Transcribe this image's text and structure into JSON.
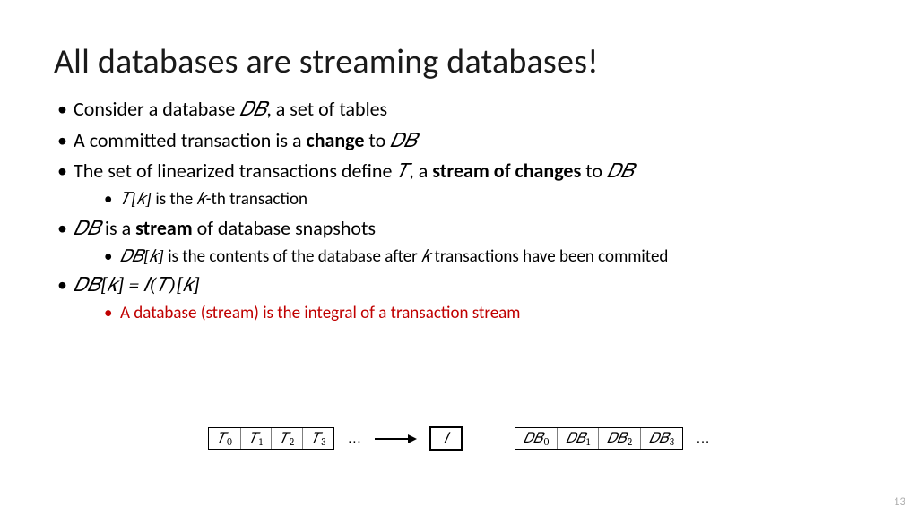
{
  "title": "All databases are streaming databases!",
  "bullets": {
    "b1_pre": "Consider a database ",
    "b1_mid": "𝐷𝐵",
    "b1_post": ", a set of tables",
    "b2_pre": "A committed transaction is a ",
    "b2_bold": "change",
    "b2_post": " to ",
    "b2_math": "𝐷𝐵",
    "b3_pre": "The set of linearized transactions define ",
    "b3_math1": "𝑇",
    "b3_mid": ", a ",
    "b3_bold": "stream of changes",
    "b3_post": " to ",
    "b3_math2": "𝐷𝐵",
    "b3a_math": "𝑇[𝑘]",
    "b3a_mid": " is the ",
    "b3a_math2": "𝑘",
    "b3a_post": "-th transaction",
    "b4_math": "𝐷𝐵",
    "b4_mid": " is a ",
    "b4_bold": "stream",
    "b4_post": " of database snapshots",
    "b4a_math": "𝐷𝐵[𝑘]",
    "b4a_mid": " is the contents of the database after ",
    "b4a_math2": "𝑘",
    "b4a_post": " transactions have been commited",
    "b5_math": "𝐷𝐵[𝑘]  =  𝐼(𝑇)[𝑘]",
    "b5a": "A database (stream) is the integral of a transaction stream"
  },
  "diagram": {
    "left_cells": [
      "𝑇",
      "𝑇",
      "𝑇",
      "𝑇"
    ],
    "left_subs": [
      "0",
      "1",
      "2",
      "3"
    ],
    "dots": "…",
    "ibox": "𝐼",
    "right_cells": [
      "𝐷𝐵",
      "𝐷𝐵",
      "𝐷𝐵",
      "𝐷𝐵"
    ],
    "right_subs": [
      "0",
      "1",
      "2",
      "3"
    ]
  },
  "page_number": "13"
}
